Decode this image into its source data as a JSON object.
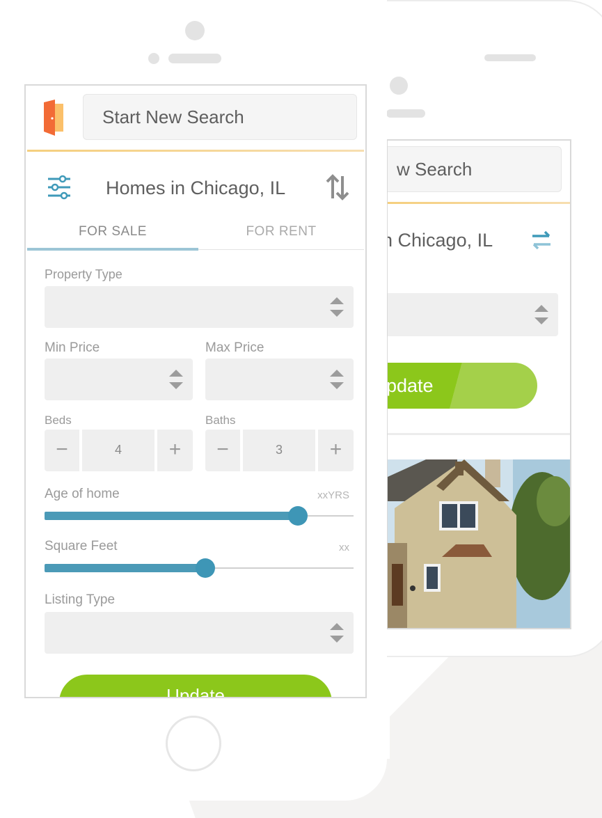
{
  "header": {
    "search_label": "Start New Search",
    "search_label_back": "w Search"
  },
  "results": {
    "title": "Homes in Chicago, IL",
    "title_back": "n Chicago, IL"
  },
  "tabs": [
    {
      "label": "FOR SALE",
      "active": true
    },
    {
      "label": "FOR RENT",
      "active": false
    }
  ],
  "filters": {
    "property_type_label": "Property Type",
    "min_price_label": "Min Price",
    "max_price_label": "Max Price",
    "beds_label": "Beds",
    "beds_value": "4",
    "baths_label": "Baths",
    "baths_value": "3",
    "minus_glyph": "−",
    "plus_glyph": "+",
    "age_label": "Age of home",
    "age_value_text": "xxYRS",
    "age_level": 0.82,
    "sqft_label": "Square Feet",
    "sqft_value_text": "xx",
    "sqft_level": 0.52,
    "listing_type_label": "Listing Type"
  },
  "buttons": {
    "update_label": "Update",
    "update_label_back": "pdate"
  },
  "colors": {
    "accent_blue": "#4b9ab7",
    "green": "#8cc71b",
    "orange_logo": "#f26b36",
    "underline_orange": "#f5cf7e"
  },
  "icons": {
    "logo": "door-logo-icon",
    "filter": "sliders-icon",
    "sort": "sort-arrows-icon",
    "swap": "swap-arrows-icon"
  }
}
